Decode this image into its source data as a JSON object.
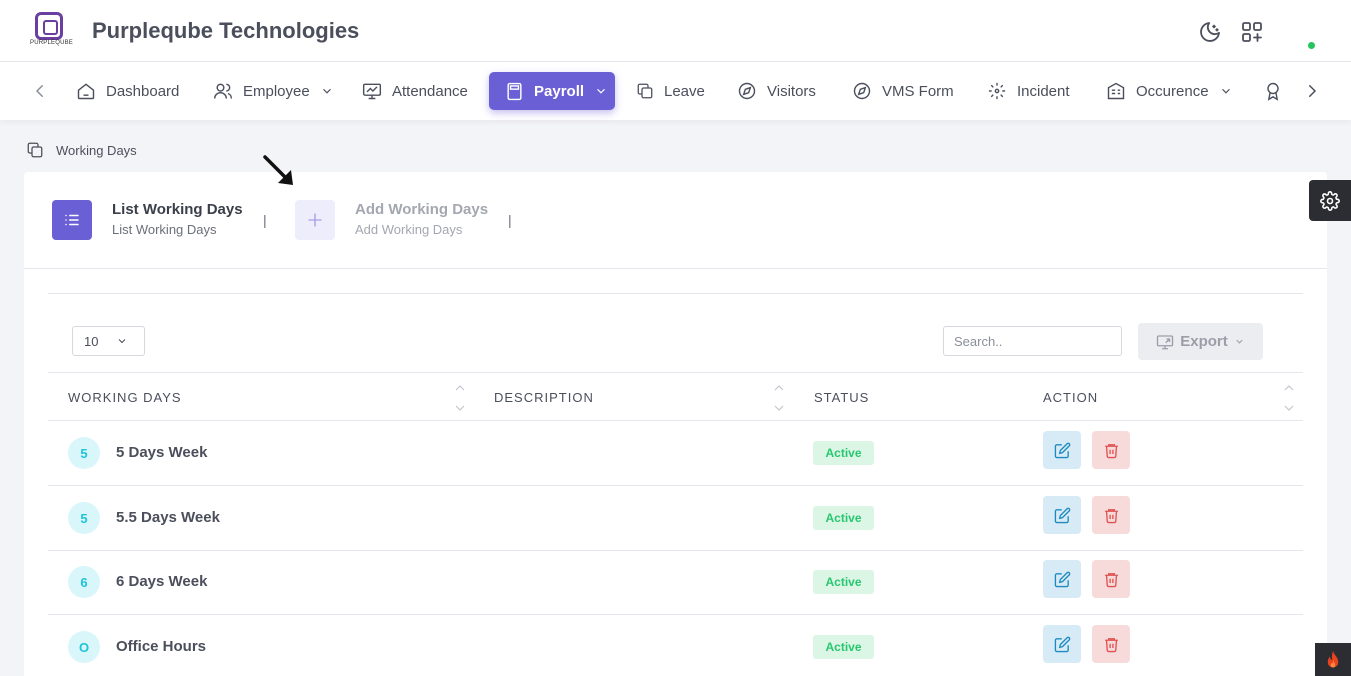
{
  "header": {
    "logo_text": "PURPLEQUBE",
    "company_name": "Purpleqube Technologies",
    "icons": [
      "moon-icon",
      "apps-add-icon"
    ],
    "online_status_color": "#22c55e"
  },
  "nav": {
    "items": [
      {
        "label": "Dashboard",
        "icon": "home-icon"
      },
      {
        "label": "Employee",
        "icon": "users-icon",
        "dropdown": true
      },
      {
        "label": "Attendance",
        "icon": "monitor-chart-icon"
      },
      {
        "label": "Payroll",
        "icon": "calculator-icon",
        "dropdown": true,
        "active": true
      },
      {
        "label": "Leave",
        "icon": "copy-icon"
      },
      {
        "label": "Visitors",
        "icon": "compass-icon"
      },
      {
        "label": "VMS Form",
        "icon": "compass-icon"
      },
      {
        "label": "Incident",
        "icon": "focus-icon"
      },
      {
        "label": "Occurence",
        "icon": "building-icon",
        "dropdown": true
      },
      {
        "label": "",
        "icon": "award-icon"
      }
    ],
    "active_color": "#6b5fd6"
  },
  "breadcrumb": {
    "label": "Working Days"
  },
  "tabs": [
    {
      "title": "List Working Days",
      "subtitle": "List Working Days",
      "active": true
    },
    {
      "title": "Add Working Days",
      "subtitle": "Add Working Days",
      "active": false
    }
  ],
  "table_controls": {
    "page_length": "10",
    "search_placeholder": "Search..",
    "export_label": "Export"
  },
  "table": {
    "columns": [
      "WORKING DAYS",
      "DESCRIPTION",
      "STATUS",
      "ACTION"
    ],
    "rows": [
      {
        "initial": "5",
        "name": "5 Days Week",
        "description": "",
        "status": "Active"
      },
      {
        "initial": "5",
        "name": "5.5 Days Week",
        "description": "",
        "status": "Active"
      },
      {
        "initial": "6",
        "name": "6 Days Week",
        "description": "",
        "status": "Active"
      },
      {
        "initial": "O",
        "name": "Office Hours",
        "description": "",
        "status": "Active"
      }
    ]
  }
}
